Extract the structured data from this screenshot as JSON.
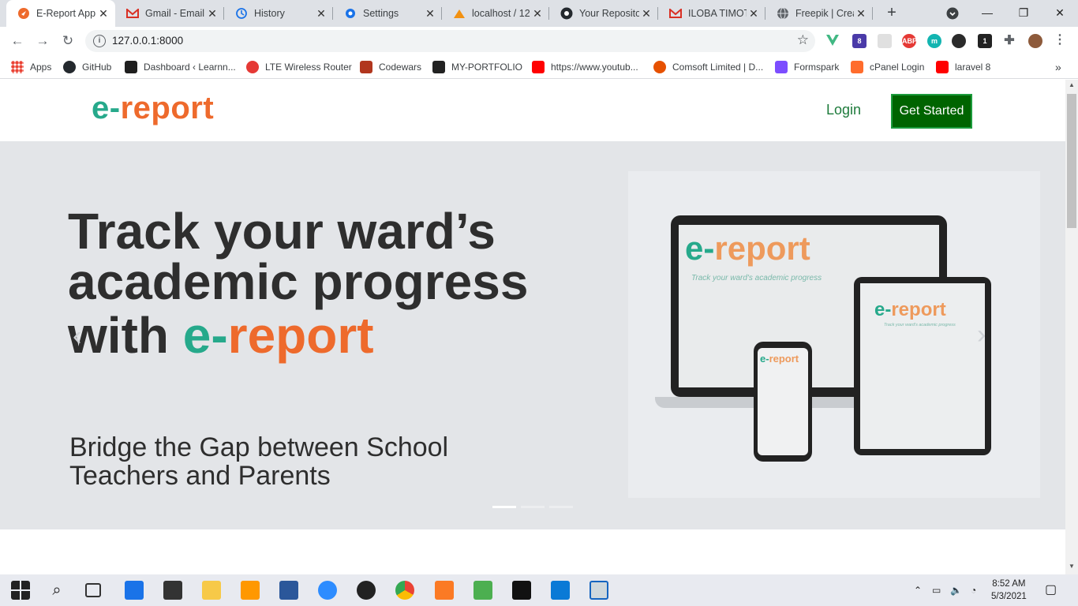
{
  "browser": {
    "tabs": [
      {
        "title": "E-Report App",
        "icon": "ereport-icon",
        "color": "#ee6a2c",
        "active": true
      },
      {
        "title": "Gmail - Email",
        "icon": "gmail-icon",
        "color": "#d93025",
        "active": false
      },
      {
        "title": "History",
        "icon": "history-icon",
        "color": "#1a73e8",
        "active": false
      },
      {
        "title": "Settings",
        "icon": "settings-icon",
        "color": "#1a73e8",
        "active": false
      },
      {
        "title": "localhost / 12",
        "icon": "phpmyadmin-icon",
        "color": "#f29111",
        "active": false
      },
      {
        "title": "Your Reposito",
        "icon": "github-icon",
        "color": "#24292e",
        "active": false
      },
      {
        "title": "ILOBA TIMOT",
        "icon": "gmail-icon",
        "color": "#d93025",
        "active": false
      },
      {
        "title": "Freepik | Crea",
        "icon": "globe-icon",
        "color": "#5f6368",
        "active": false
      }
    ],
    "new_tab": "+",
    "address": "127.0.0.1:8000",
    "bookmarks": [
      {
        "label": "Apps",
        "color": "#ea4335"
      },
      {
        "label": "GitHub",
        "color": "#24292e"
      },
      {
        "label": "Dashboard ‹ Learnn...",
        "color": "#1f1f1f"
      },
      {
        "label": "LTE Wireless Router",
        "color": "#e53935"
      },
      {
        "label": "Codewars",
        "color": "#b1361e"
      },
      {
        "label": "MY-PORTFOLIO",
        "color": "#222222"
      },
      {
        "label": "https://www.youtub...",
        "color": "#ff0000"
      },
      {
        "label": "Comsoft Limited | D...",
        "color": "#e65100"
      },
      {
        "label": "Formspark",
        "color": "#7c4dff"
      },
      {
        "label": "cPanel Login",
        "color": "#ff6c2c"
      },
      {
        "label": "laravel 8",
        "color": "#ff0000"
      }
    ]
  },
  "site": {
    "logo_e": "e-",
    "logo_rest": "report",
    "login": "Login",
    "cta": "Get Started",
    "hero": {
      "line1": "Track your ward’s",
      "line2": "academic progress",
      "line3_prefix": "with ",
      "line3_brand_e": "e-",
      "line3_brand_rest": "report",
      "subtitle_line1": "Bridge the Gap between School",
      "subtitle_line2": "Teachers and Parents"
    },
    "device_logo_e": "e-",
    "device_logo_rest": "report",
    "device_tagline": "Track your ward's academic progress",
    "slide_count": 3,
    "active_slide": 1
  },
  "colors": {
    "brand_teal": "#26a98b",
    "brand_orange": "#ee6a2c",
    "cta_green": "#006400",
    "login_green": "#1e7b3c"
  },
  "taskbar": {
    "time": "8:52 AM",
    "date": "5/3/2021"
  }
}
